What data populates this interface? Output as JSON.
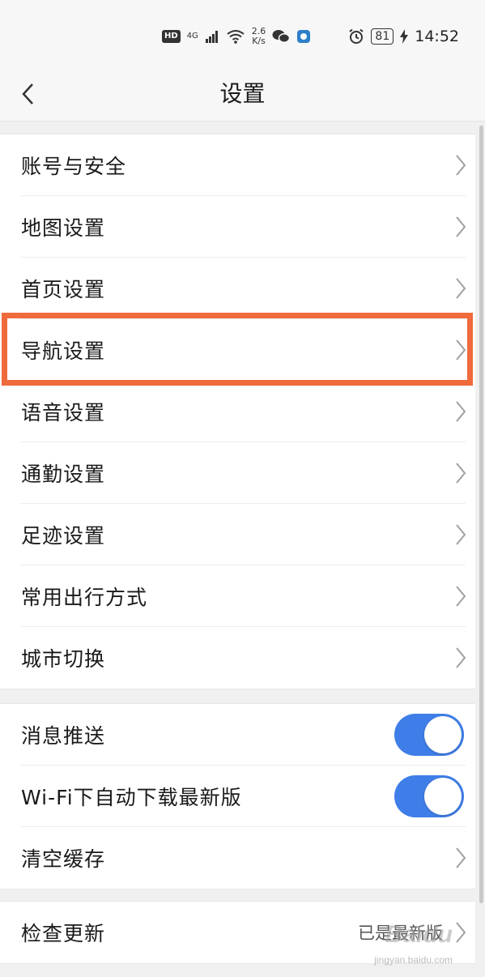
{
  "status_bar": {
    "hd": "HD",
    "network": "4G",
    "speed_value": "2.6",
    "speed_unit": "K/s",
    "battery": "81",
    "time": "14:52",
    "icons": [
      "signal-icon",
      "wifi-icon",
      "wechat-icon",
      "app-icon",
      "alarm-icon",
      "charging-icon"
    ]
  },
  "header": {
    "title": "设置"
  },
  "group1": {
    "items": [
      {
        "label": "账号与安全"
      },
      {
        "label": "地图设置"
      },
      {
        "label": "首页设置"
      },
      {
        "label": "导航设置"
      },
      {
        "label": "语音设置"
      },
      {
        "label": "通勤设置"
      },
      {
        "label": "足迹设置"
      },
      {
        "label": "常用出行方式"
      },
      {
        "label": "城市切换"
      }
    ]
  },
  "group2": {
    "items": [
      {
        "label": "消息推送",
        "toggle": true
      },
      {
        "label": "Wi-Fi下自动下载最新版",
        "toggle": true
      },
      {
        "label": "清空缓存"
      }
    ]
  },
  "group3": {
    "items": [
      {
        "label": "检查更新",
        "value": "已是最新版"
      }
    ]
  },
  "watermark": {
    "text": "Baidu",
    "sub": "jingyan.baidu.com"
  },
  "colors": {
    "accent": "#3f7ee8",
    "highlight": "#f06a3c",
    "background": "#f0f0f0"
  }
}
